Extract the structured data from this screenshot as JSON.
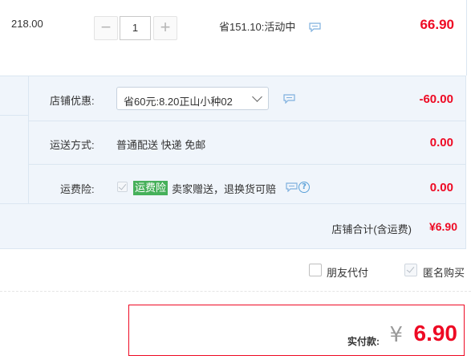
{
  "item": {
    "price": "218.00",
    "quantity": "1",
    "minus_symbol": "−",
    "plus_symbol": "+",
    "promo_text": "省151.10:活动中",
    "subtotal": "66.90"
  },
  "shop": {
    "discount": {
      "label": "店铺优惠:",
      "selected": "省60元:8.20正山小种02",
      "amount": "-60.00"
    },
    "shipping": {
      "label": "运送方式:",
      "value": "普通配送 快递 免邮",
      "amount": "0.00"
    },
    "insurance": {
      "label": "运费险:",
      "checked": true,
      "badge": "运费险",
      "value": "卖家赠送，退换货可赔",
      "help_symbol": "?",
      "amount": "0.00"
    },
    "total_label": "店铺合计(含运费)",
    "total_value": "¥6.90"
  },
  "options": {
    "friend_pay": {
      "label": "朋友代付",
      "checked": false
    },
    "anonymous": {
      "label": "匿名购买",
      "checked": true
    }
  },
  "payment": {
    "label": "实付款:",
    "currency": "¥",
    "amount": "6.90"
  },
  "colors": {
    "accent_red": "#ee0a24",
    "badge_green": "#46b05a",
    "panel_blue": "#f0f5fb",
    "icon_blue": "#5aa0d8"
  },
  "icons": {
    "promo_chat": "chat-bubble-icon",
    "discount_chat": "chat-bubble-icon",
    "insurance_chat": "chat-bubble-icon",
    "insurance_help": "question-circle-icon",
    "dropdown": "chevron-down-icon"
  }
}
